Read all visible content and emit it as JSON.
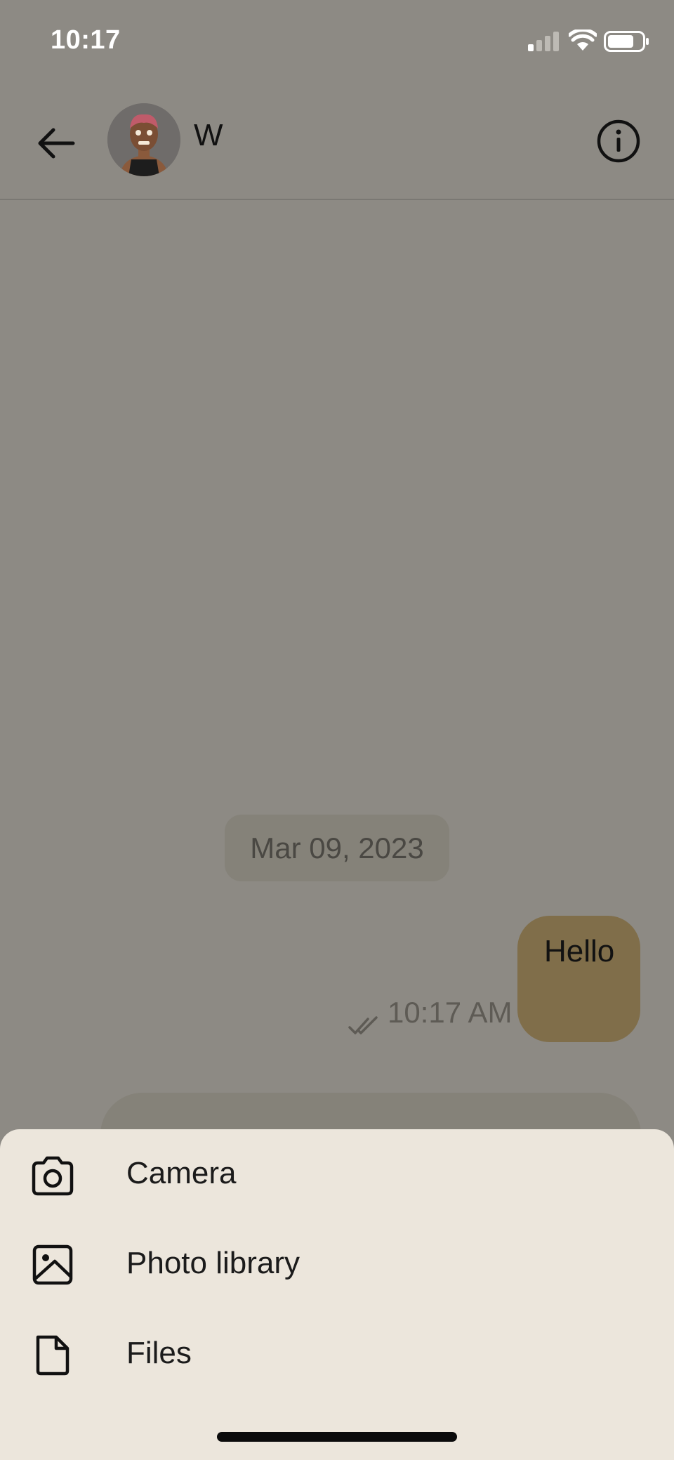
{
  "status_bar": {
    "time": "10:17"
  },
  "header": {
    "contact_name": "W"
  },
  "chat": {
    "date_label": "Mar 09, 2023",
    "messages": [
      {
        "text": "Hello",
        "time": "10:17 AM",
        "status": "read"
      }
    ]
  },
  "attachment_menu": {
    "items": [
      {
        "label": "Camera",
        "icon": "camera-icon"
      },
      {
        "label": "Photo library",
        "icon": "photo-library-icon"
      },
      {
        "label": "Files",
        "icon": "file-icon"
      }
    ]
  },
  "colors": {
    "overlay_background": "#8d8a84",
    "sent_bubble": "#806e4a",
    "sheet_background": "#ece6dc"
  }
}
